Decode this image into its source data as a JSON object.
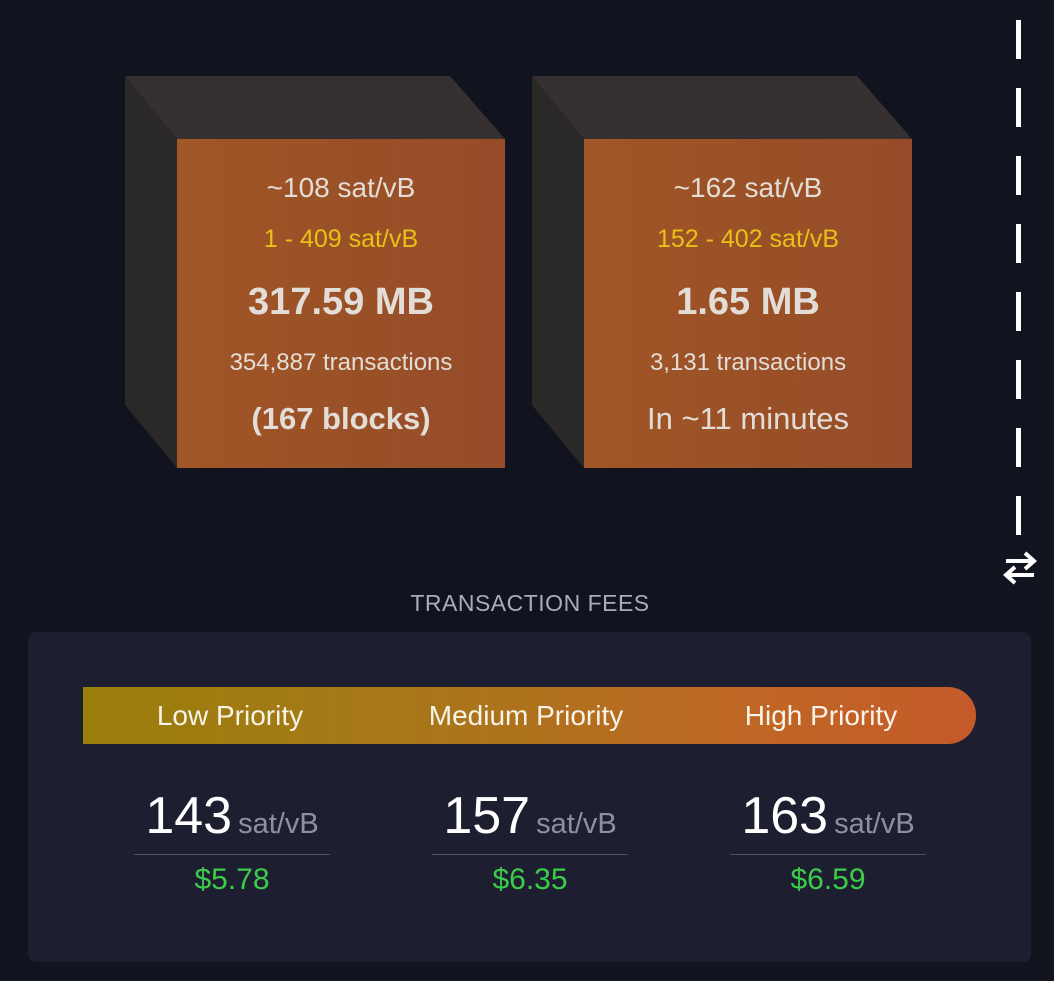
{
  "blocks": [
    {
      "fee": "~108 sat/vB",
      "range": "1 - 409 sat/vB",
      "size": "317.59 MB",
      "transactions": "354,887 transactions",
      "extra": "(167 blocks)"
    },
    {
      "fee": "~162 sat/vB",
      "range": "152 - 402 sat/vB",
      "size": "1.65 MB",
      "transactions": "3,131 transactions",
      "extra": "In ~11 minutes"
    }
  ],
  "divider": {
    "toggle_icon": "swap-arrows-icon"
  },
  "fees": {
    "title": "TRANSACTION FEES",
    "priorities": [
      {
        "label": "Low Priority",
        "rate": "143",
        "unit": "sat/vB",
        "usd": "$5.78"
      },
      {
        "label": "Medium Priority",
        "rate": "157",
        "unit": "sat/vB",
        "usd": "$6.35"
      },
      {
        "label": "High Priority",
        "rate": "163",
        "unit": "sat/vB",
        "usd": "$6.59"
      }
    ]
  },
  "colors": {
    "background": "#11131f",
    "block_face": "#a05626",
    "fee_range": "#e8c016",
    "usd": "#3bcc49",
    "card": "#1d1f31"
  }
}
